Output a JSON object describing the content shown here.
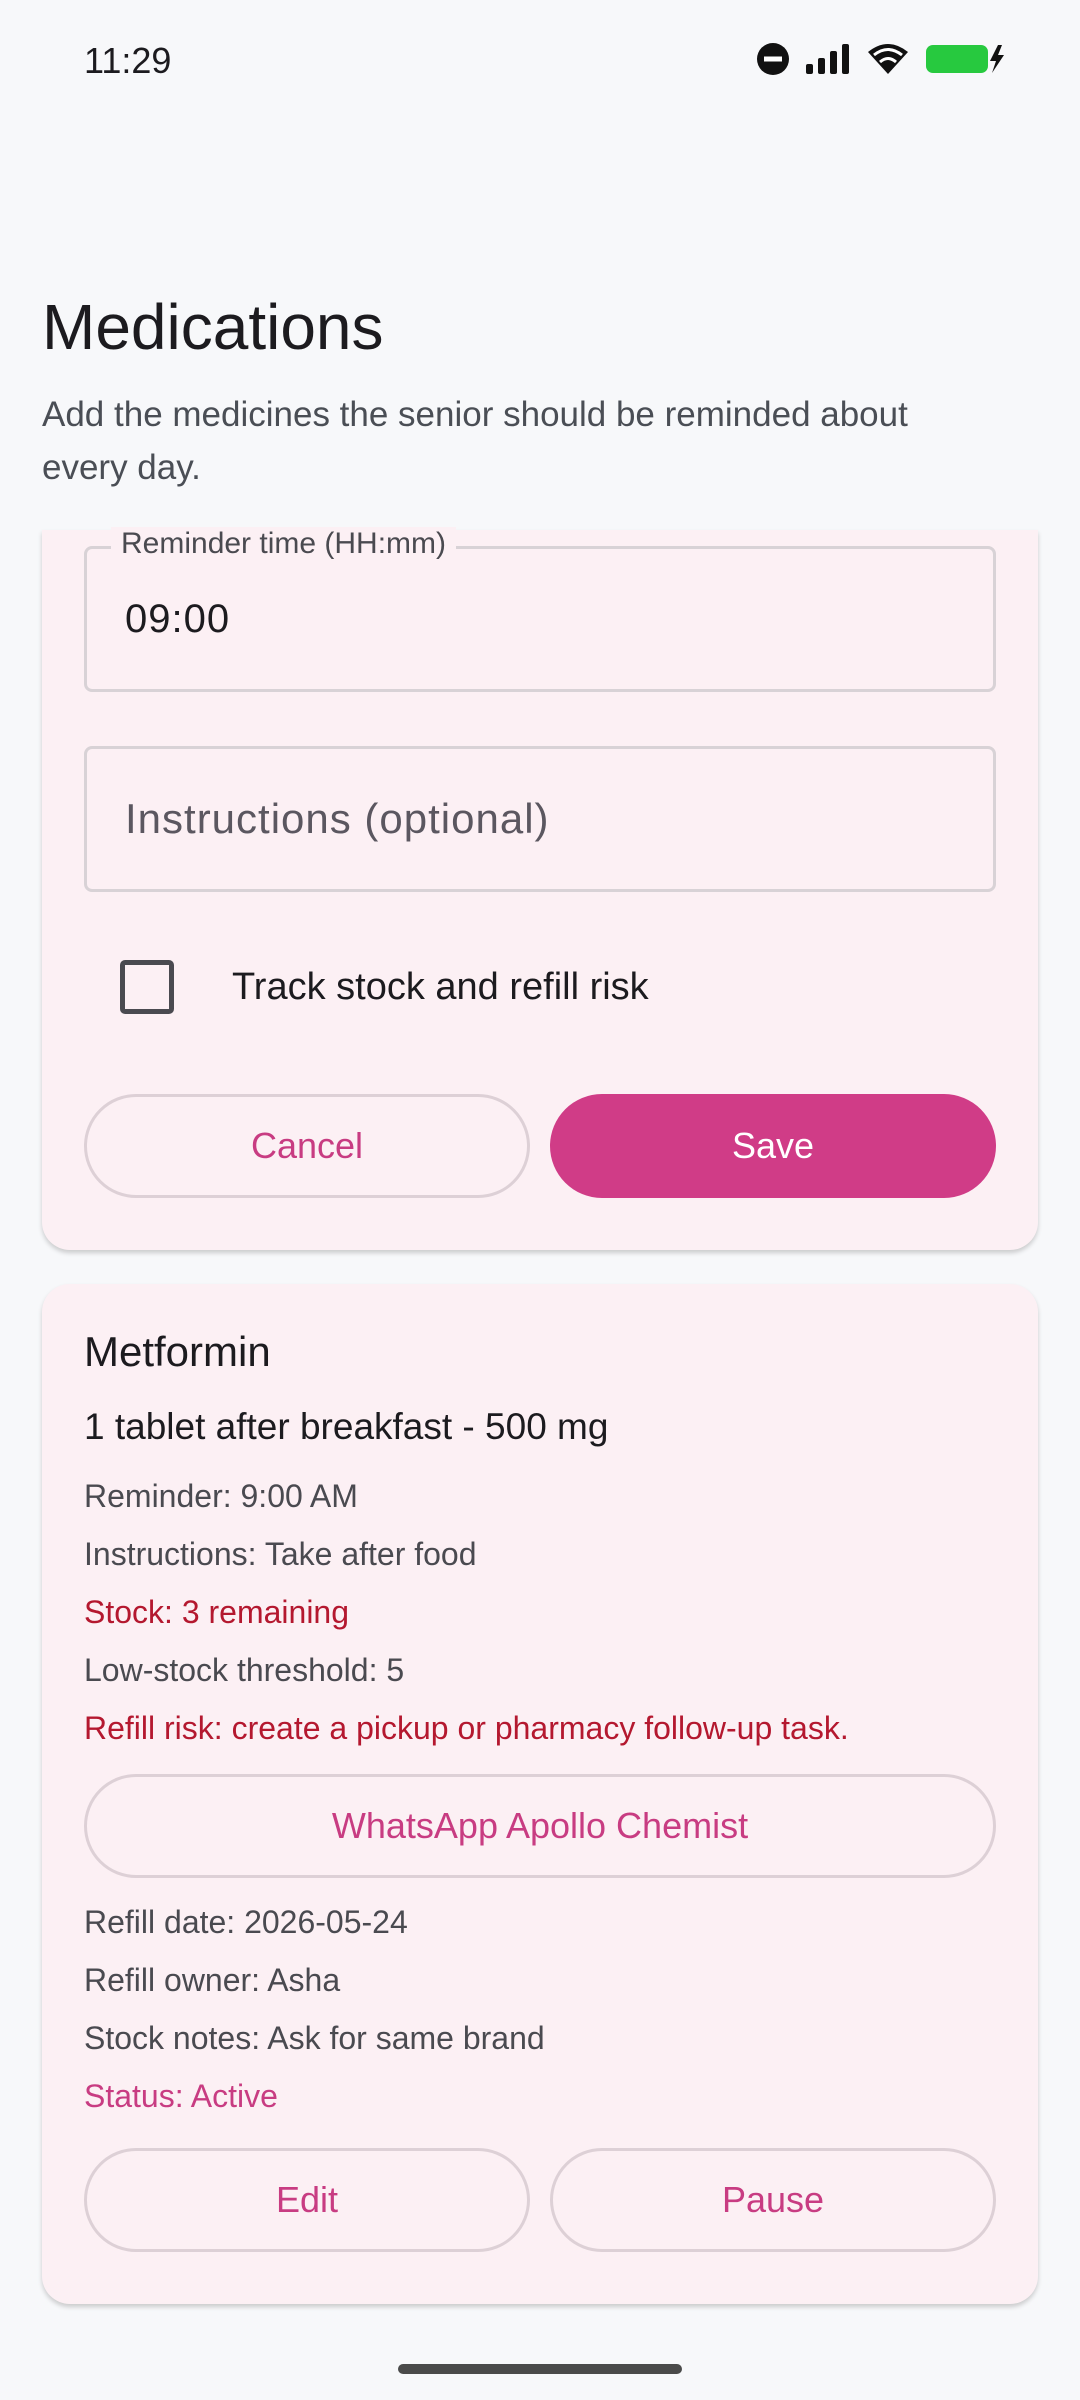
{
  "status_bar": {
    "time": "11:29",
    "icons": [
      "do-not-disturb-icon",
      "signal-icon",
      "wifi-icon",
      "battery-charging-icon"
    ]
  },
  "header": {
    "title": "Medications",
    "subtitle": "Add the medicines the senior should be reminded about every day."
  },
  "form": {
    "reminder_time_label": "Reminder time (HH:mm)",
    "reminder_time_value": "09:00",
    "instructions_placeholder": "Instructions (optional)",
    "track_stock_label": "Track stock and refill risk",
    "track_stock_checked": false,
    "cancel_label": "Cancel",
    "save_label": "Save"
  },
  "medication": {
    "name": "Metformin",
    "dose": "1 tablet after breakfast - 500 mg",
    "reminder": "Reminder: 9:00 AM",
    "instructions": "Instructions: Take after food",
    "stock": "Stock: 3 remaining",
    "threshold": "Low-stock threshold: 5",
    "refill_risk": "Refill risk: create a pickup or pharmacy follow-up task.",
    "whatsapp_label": "WhatsApp Apollo Chemist",
    "refill_date": "Refill date: 2026-05-24",
    "refill_owner": "Refill owner: Asha",
    "stock_notes": "Stock notes: Ask for same brand",
    "status": "Status: Active",
    "edit_label": "Edit",
    "pause_label": "Pause"
  },
  "colors": {
    "accent": "#d03c87",
    "accent_text": "#c83c82",
    "warning": "#b4182f",
    "card_bg": "#fcf0f4",
    "page_bg": "#f7f8fa"
  }
}
